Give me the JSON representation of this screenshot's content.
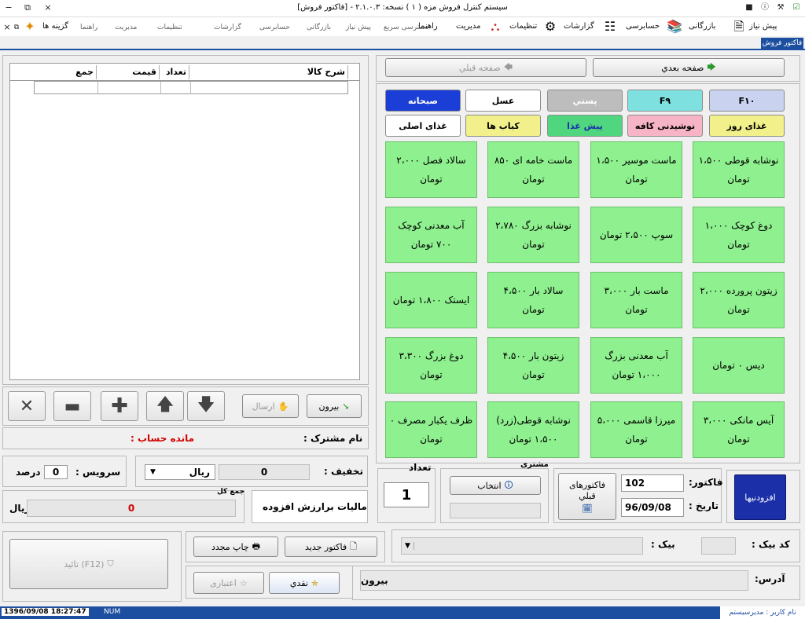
{
  "window": {
    "title": "سیستم کنترل فروش مزه ( ۱ )   نسخه: ۲.۱.۰.۳ - [فاکتور فروش]",
    "minimize": "−",
    "restore": "⧉",
    "close": "×"
  },
  "menubar": {
    "items": [
      {
        "label": "پیش نیاز",
        "icon": "document-settings-icon"
      },
      {
        "label": "بازرگانی",
        "icon": "books-icon"
      },
      {
        "label": "حسابرسی",
        "icon": "checklist-icon"
      },
      {
        "label": "گزارشات",
        "icon": "gear-icon"
      },
      {
        "label": "تنظیمات",
        "icon": "org-chart-icon"
      },
      {
        "label": "مدیریت",
        "icon": ""
      },
      {
        "label": "راهنما",
        "icon": ""
      },
      {
        "label": "گزینه ها",
        "icon": "gift-icon"
      }
    ],
    "quick_access_label": "دسترسی سریع",
    "sub_items": [
      "پیش نیاز",
      "بازرگانی",
      "حسابرسی",
      "گزارشات",
      "تنظیمات",
      "مدیریت",
      "راهنما"
    ],
    "active_tab": "فاکتور فروش"
  },
  "grid": {
    "headers": [
      "شرح کالا",
      "تعداد",
      "قیمت",
      "جمع"
    ]
  },
  "grid_toolbar": {
    "outside_label": "بیرون",
    "send_label": "ارسال"
  },
  "customer": {
    "name_label": "نام مشترک :",
    "balance_label": "مانده حساب :"
  },
  "service": {
    "label": "سرویس :",
    "value": "0",
    "unit": "درصد"
  },
  "discount": {
    "label": "تخفیف :",
    "value": "0",
    "currency": "ریال"
  },
  "tax": {
    "label": "مالیات برارزش افزوده",
    "total_label": "جمع کل",
    "total_value": "0",
    "currency": "ریال"
  },
  "actions": {
    "confirm_label": "تائید (F12)",
    "reprint_label": "چاپ مجدد",
    "new_invoice_label": "فاکتور جدید",
    "credit_label": "اعتباری",
    "cash_label": "نقدي"
  },
  "paging": {
    "prev_label": "صفحه قبلي",
    "next_label": "صفحه بعدي"
  },
  "categories": {
    "row1": [
      {
        "label": "F۱۰",
        "color": "#c9d3f0"
      },
      {
        "label": "F۹",
        "color": "#7fe0e0"
      },
      {
        "label": "پستي",
        "color": "#bdbdbd"
      },
      {
        "label": "عسل",
        "color": "#ffffff"
      },
      {
        "label": "صبحانه",
        "color": "#1b3fd6"
      }
    ],
    "row2": [
      {
        "label": "غذای روز",
        "color": "#f2f08a"
      },
      {
        "label": "نوشیدنی کافه",
        "color": "#f6b4c6"
      },
      {
        "label": "پیش غذا",
        "color": "#4fd67f"
      },
      {
        "label": "کباب ها",
        "color": "#f2f08a"
      },
      {
        "label": "غذای اصلی",
        "color": "#ffffff"
      }
    ]
  },
  "items": [
    "نوشابه قوطی ۱،۵۰۰ تومان",
    "ماست موسیر ۱،۵۰۰ تومان",
    "ماست خامه ای ۸۵۰ تومان",
    "سالاد فصل ۲،۰۰۰ تومان",
    "دوغ کوچک ۱،۰۰۰ تومان",
    "سوپ ۲،۵۰۰ تومان",
    "نوشابه بزرگ ۲،۷۸۰ تومان",
    "آب معدنی کوچک ۷۰۰ تومان",
    "زیتون پرورده ۲،۰۰۰ تومان",
    "ماست بار ۳،۰۰۰ تومان",
    "سالاد بار ۴،۵۰۰ تومان",
    "ایستک ۱،۸۰۰ تومان",
    "دیس ۰ تومان",
    "آب معدنی بزرگ ۱،۰۰۰ تومان",
    "زیتون بار ۴،۵۰۰ تومان",
    "دوغ بزرگ ۳،۳۰۰ تومان",
    "آیس مانکی ۳،۰۰۰ تومان",
    "میرزا قاسمی ۵،۰۰۰ تومان",
    "نوشابه قوطی(زرد) ۱،۵۰۰ تومان",
    "ظرف یکبار مصرف ۰ تومان"
  ],
  "invoice": {
    "addons_label": "افزودنیها",
    "invoice_label": "فاکتور:",
    "invoice_number": "102",
    "date_label": "تاریخ :",
    "date_value": "96/09/08",
    "prev_invoices_label": "فاکتورهای قبلي",
    "customer_label": "مشتری",
    "select_label": "انتخاب",
    "count_label": "تعداد",
    "count_value": "1"
  },
  "bank": {
    "code_label": "کد بیک :",
    "bank_label": "بیک :"
  },
  "address": {
    "label": "آدرس:",
    "value": "بیرون"
  },
  "status": {
    "datetime": "1396/09/08  18:27:47",
    "numlock": "NUM",
    "user": "نام کاربر : مدیرسیستم"
  },
  "colors": {
    "accent": "#1c4fa0",
    "item_green": "#8ef08e",
    "addons_blue": "#1b2fa8",
    "balance_red": "#d40000"
  }
}
